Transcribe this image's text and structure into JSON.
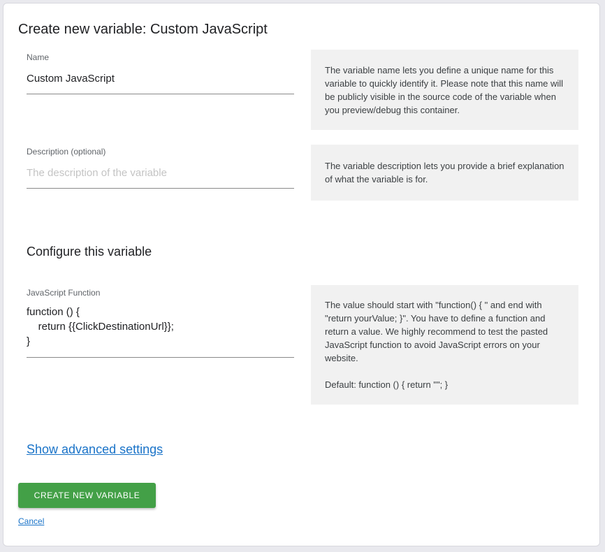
{
  "dialog": {
    "title": "Create new variable: Custom JavaScript"
  },
  "name_field": {
    "label": "Name",
    "value": "Custom JavaScript",
    "help": "The variable name lets you define a unique name for this variable to quickly identify it. Please note that this name will be publicly visible in the source code of the variable when you preview/debug this container."
  },
  "description_field": {
    "label": "Description (optional)",
    "placeholder": "The description of the variable",
    "value": "",
    "help": "The variable description lets you provide a brief explanation of what the variable is for."
  },
  "configure": {
    "title": "Configure this variable",
    "js_function": {
      "label": "JavaScript Function",
      "value": "function () {\n    return {{ClickDestinationUrl}};\n}",
      "help": "The value should start with \"function() { \" and end with \"return yourValue; }\". You have to define a function and return a value. We highly recommend to test the pasted JavaScript function to avoid JavaScript errors on your website.\n\nDefault: function () { return \"\"; }"
    }
  },
  "advanced": {
    "link_label": "Show advanced settings"
  },
  "actions": {
    "create_label": "CREATE NEW VARIABLE",
    "cancel_label": "Cancel"
  },
  "colors": {
    "primary_button": "#43a047",
    "link": "#1a73c8",
    "help_background": "#f1f1f1"
  }
}
